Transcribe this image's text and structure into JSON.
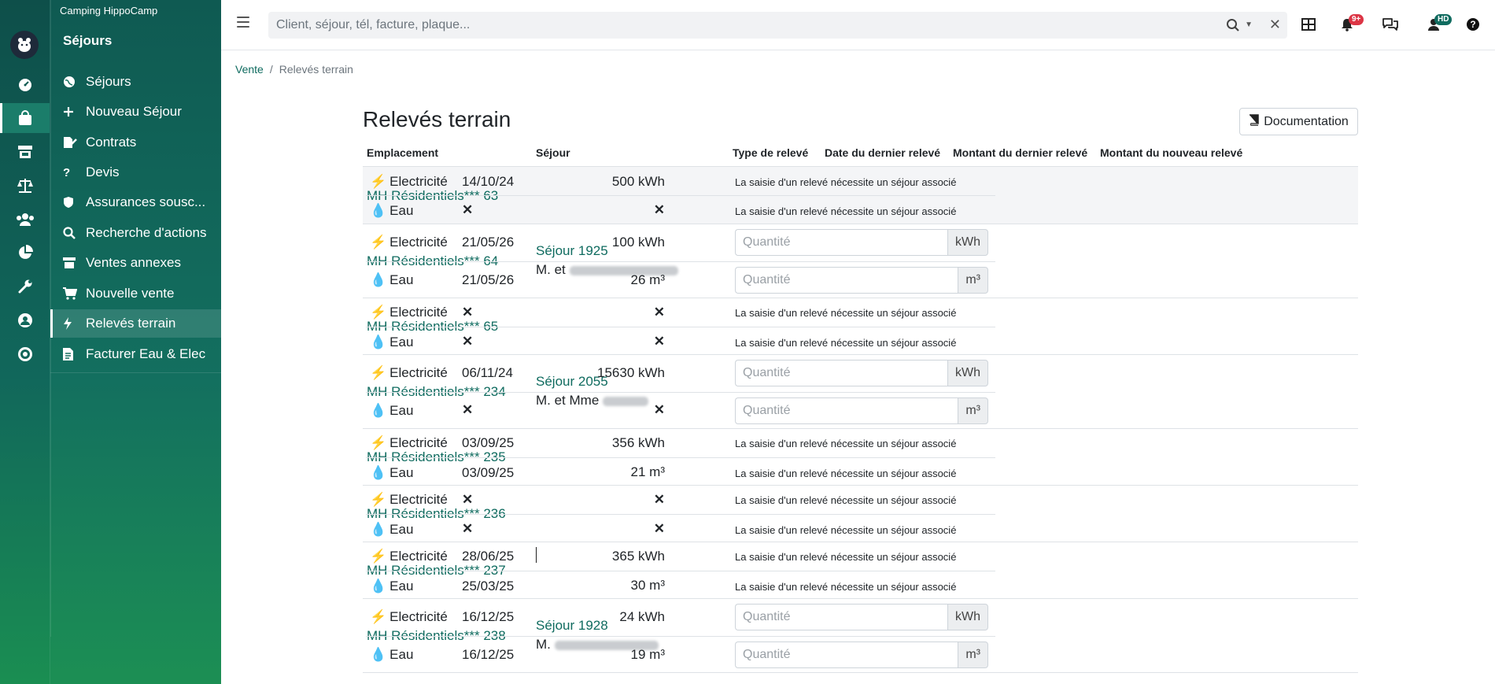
{
  "app": {
    "company": "Camping HippoCamp",
    "section": "Séjours"
  },
  "menu": {
    "items": [
      {
        "label": "Séjours",
        "icon": "globe-icon"
      },
      {
        "label": "Nouveau Séjour",
        "icon": "plus-icon"
      },
      {
        "label": "Contrats",
        "icon": "signature-icon"
      },
      {
        "label": "Devis",
        "icon": "question-icon"
      },
      {
        "label": "Assurances sousc...",
        "icon": "shield-icon"
      },
      {
        "label": "Recherche d'actions",
        "icon": "search-icon"
      },
      {
        "label": "Ventes annexes",
        "icon": "store-icon"
      },
      {
        "label": "Nouvelle vente",
        "icon": "cart-icon"
      },
      {
        "label": "Relevés terrain",
        "icon": "bolt-icon"
      },
      {
        "label": "Facturer Eau & Elec",
        "icon": "invoice-icon"
      }
    ],
    "active": "Relevés terrain"
  },
  "topbar": {
    "search_placeholder": "Client, séjour, tél, facture, plaque...",
    "notifications_badge": "9+",
    "user_initials": "HD"
  },
  "breadcrumb": {
    "parent": "Vente",
    "current": "Relevés terrain"
  },
  "page": {
    "title": "Relevés terrain",
    "doc_button": "Documentation",
    "columns": [
      "Emplacement",
      "Séjour",
      "Type de relevé",
      "Date du dernier relevé",
      "Montant du dernier relevé",
      "Montant du nouveau relevé"
    ]
  },
  "labels": {
    "elec": "Electricité",
    "eau": "Eau",
    "missing": "✕",
    "needs_stay": "La saisie d'un relevé nécessite un séjour associé",
    "qty_placeholder": "Quantité",
    "unit_kwh": "kWh",
    "unit_m3": "m³"
  },
  "rows": [
    {
      "emplacement": "MH Résidentiels*** 63",
      "sejour": "",
      "client_prefix": "",
      "elec": {
        "date": "14/10/24",
        "amount": "500 kWh"
      },
      "eau": {
        "date": "",
        "amount": ""
      }
    },
    {
      "emplacement": "MH Résidentiels*** 64",
      "sejour": "Séjour 1925",
      "client_prefix": "M. et",
      "elec": {
        "date": "21/05/26",
        "amount": "100 kWh"
      },
      "eau": {
        "date": "21/05/26",
        "amount": "26 m³"
      }
    },
    {
      "emplacement": "MH Résidentiels*** 65",
      "sejour": "",
      "client_prefix": "",
      "elec": {
        "date": "",
        "amount": ""
      },
      "eau": {
        "date": "",
        "amount": ""
      }
    },
    {
      "emplacement": "MH Résidentiels*** 234",
      "sejour": "Séjour 2055",
      "client_prefix": "M. et Mme",
      "elec": {
        "date": "06/11/24",
        "amount": "15630 kWh"
      },
      "eau": {
        "date": "",
        "amount": ""
      }
    },
    {
      "emplacement": "MH Résidentiels*** 235",
      "sejour": "",
      "client_prefix": "",
      "elec": {
        "date": "03/09/25",
        "amount": "356 kWh"
      },
      "eau": {
        "date": "03/09/25",
        "amount": "21 m³"
      }
    },
    {
      "emplacement": "MH Résidentiels*** 236",
      "sejour": "",
      "client_prefix": "",
      "elec": {
        "date": "",
        "amount": ""
      },
      "eau": {
        "date": "",
        "amount": ""
      }
    },
    {
      "emplacement": "MH Résidentiels*** 237",
      "sejour": "",
      "client_prefix": "",
      "elec": {
        "date": "28/06/25",
        "amount": "365 kWh"
      },
      "eau": {
        "date": "25/03/25",
        "amount": "30 m³"
      }
    },
    {
      "emplacement": "MH Résidentiels*** 238",
      "sejour": "Séjour 1928",
      "client_prefix": "M.",
      "elec": {
        "date": "16/12/25",
        "amount": "24 kWh"
      },
      "eau": {
        "date": "16/12/25",
        "amount": "19 m³"
      }
    }
  ],
  "colors": {
    "accent": "#0f6b5f",
    "badge_red": "#dc3545",
    "bolt": "#f0ad1e",
    "drop": "#1a8fb5"
  }
}
